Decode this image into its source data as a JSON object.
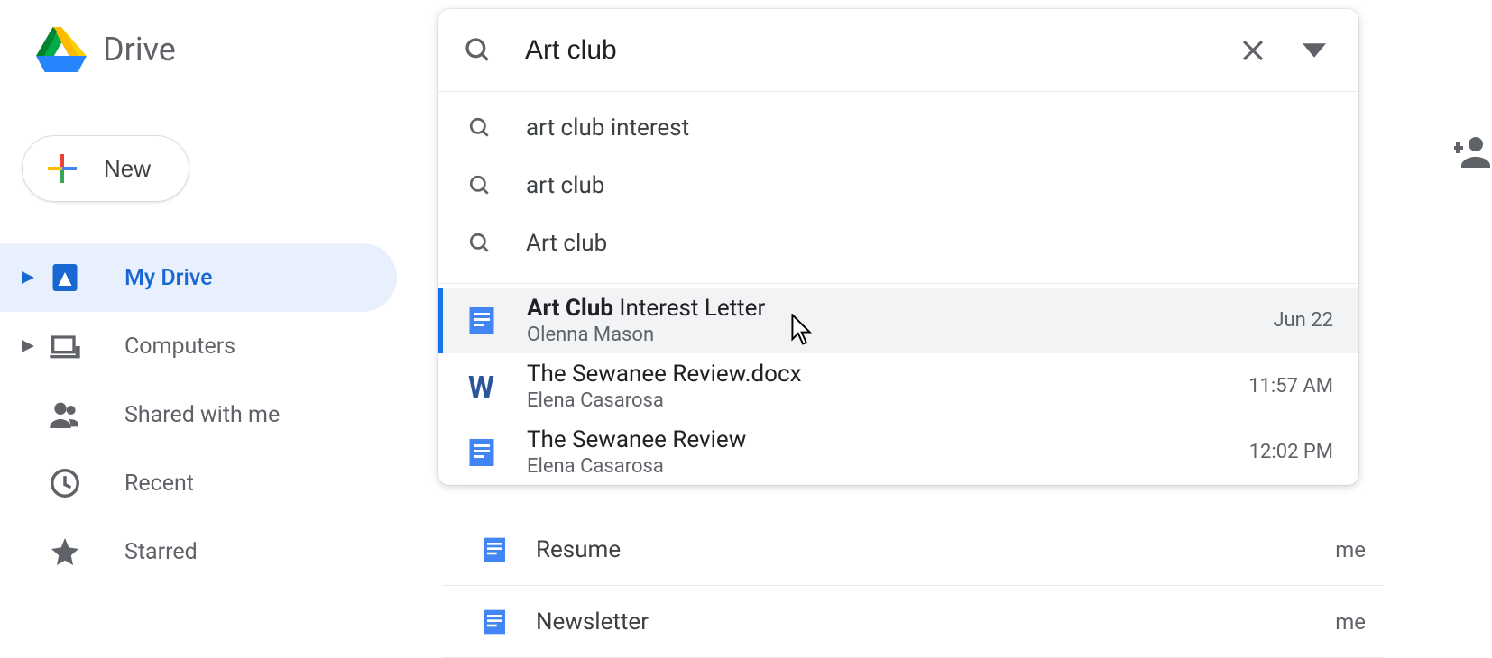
{
  "header": {
    "product_name": "Drive"
  },
  "sidebar": {
    "new_label": "New",
    "items": [
      {
        "label": "My Drive",
        "active": true,
        "icon": "drive-icon",
        "expandable": true
      },
      {
        "label": "Computers",
        "active": false,
        "icon": "computers-icon",
        "expandable": true
      },
      {
        "label": "Shared with me",
        "active": false,
        "icon": "shared-icon",
        "expandable": false
      },
      {
        "label": "Recent",
        "active": false,
        "icon": "recent-icon",
        "expandable": false
      },
      {
        "label": "Starred",
        "active": false,
        "icon": "star-icon",
        "expandable": false
      }
    ]
  },
  "search": {
    "value": "Art club",
    "suggestions": [
      "art club interest",
      "art club",
      "Art club"
    ],
    "results": [
      {
        "title_bold": "Art Club",
        "title_rest": " Interest Letter",
        "owner": "Olenna Mason",
        "time": "Jun 22",
        "icon": "docs",
        "hovered": true
      },
      {
        "title_bold": "",
        "title_rest": "The Sewanee Review.docx",
        "owner": "Elena Casarosa",
        "time": "11:57 AM",
        "icon": "word",
        "hovered": false
      },
      {
        "title_bold": "",
        "title_rest": "The Sewanee Review",
        "owner": "Elena Casarosa",
        "time": "12:02 PM",
        "icon": "docs",
        "hovered": false
      }
    ]
  },
  "main": {
    "rows": [
      {
        "title": "Resume",
        "owner": "me",
        "icon": "docs"
      },
      {
        "title": "Newsletter",
        "owner": "me",
        "icon": "docs"
      }
    ]
  }
}
